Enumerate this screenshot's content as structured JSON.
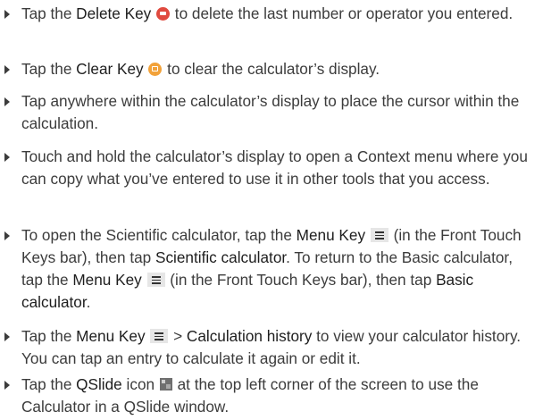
{
  "items": [
    {
      "t1": "Tap the ",
      "b1": "Delete Key",
      "t2": " ",
      "icon": "delete-key-icon",
      "t3": " to delete the last number or operator you entered."
    },
    {
      "t1": "Tap the ",
      "b1": "Clear Key",
      "t2": " ",
      "icon": "clear-key-icon",
      "t3": " to clear the calculator’s display."
    },
    {
      "t1": "Tap anywhere within the calculator’s display to place the cursor within the calculation."
    },
    {
      "t1": "Touch and hold the calculator’s display to open a Context menu where you can copy what you’ve entered to use it in other tools that you access."
    },
    {
      "t1": "To open the Scientific calculator, tap the ",
      "b1": "Menu Key",
      "t2": " (in the Front Touch Keys bar), then tap ",
      "b2": "Scientific calculator",
      "t3": ". To return to the Basic calculator, tap the ",
      "b3": "Menu Key",
      "t4": " (in the Front Touch Keys bar), then tap ",
      "b4": "Basic calculator",
      "t5": "."
    },
    {
      "t1": "Tap the ",
      "b1": "Menu Key",
      "t2": " > ",
      "b2": "Calculation history",
      "t3": " to view your calculator history. You can tap an entry to calculate it again or edit it."
    },
    {
      "t1": "Tap the ",
      "b1": "QSlide",
      "t2": " icon ",
      "t3": " at the top left corner of the screen to use the Calculator in a QSlide window."
    }
  ],
  "colors": {
    "text": "#3c3c3c",
    "delete_icon": "#e04a3f",
    "clear_icon": "#f2a23a"
  }
}
